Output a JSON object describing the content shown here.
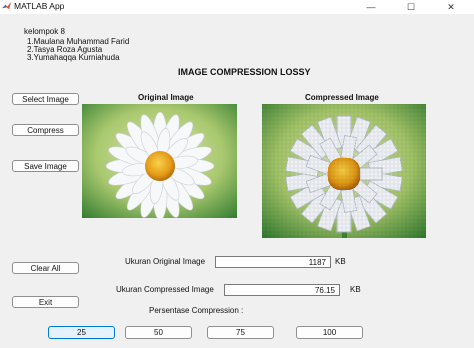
{
  "window": {
    "title": "MATLAB App",
    "minimize": "—",
    "maximize": "☐",
    "close": "✕"
  },
  "group": {
    "name": "kelompok 8",
    "members": [
      "1.Maulana Muhammad Farid",
      "2.Tasya Roza Agusta",
      "3.Yumahaqqa Kurniahuda"
    ]
  },
  "heading": "IMAGE COMPRESSION LOSSY",
  "buttons": {
    "select": "Select Image",
    "compress": "Compress",
    "save": "Save Image",
    "clear": "Clear All",
    "exit": "Exit"
  },
  "panels": {
    "original_label": "Original Image",
    "compressed_label": "Compressed Image"
  },
  "sizes": {
    "original_label": "Ukuran Original Image",
    "original_value": "1187",
    "original_unit": "KB",
    "compressed_label": "Ukuran  Compressed Image",
    "compressed_value": "76.15",
    "compressed_unit": "KB"
  },
  "percent": {
    "label": "Persentase Compression :",
    "options": [
      "25",
      "50",
      "75",
      "100"
    ],
    "selected": "25"
  },
  "colors": {
    "accent": "#0078d7",
    "petal": "#f4f6f8",
    "center": "#e8a21a",
    "background_green": "#3f8f3a"
  },
  "icons": {
    "app": "matlab-icon"
  }
}
